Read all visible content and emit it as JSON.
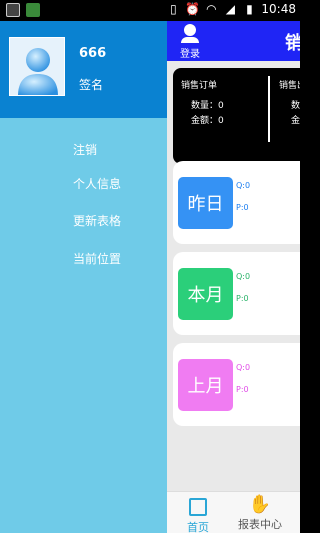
{
  "statusbar": {
    "time": "10:48"
  },
  "topbar": {
    "login_label": "登录",
    "title": "销"
  },
  "summary": {
    "title_left": "销售订单",
    "qty_left": "数量：0",
    "amt_left": "金额：0",
    "title_right": "销售出",
    "qty_right": "数量",
    "amt_right": "金额"
  },
  "cards": [
    {
      "label": "昨日",
      "q": "Q:0",
      "p": "P:0",
      "color": "#3592f4",
      "qcolor": "#1e7ff0",
      "pcolor": "#1e7ff0"
    },
    {
      "label": "本月",
      "q": "Q:0",
      "p": "P:0",
      "color": "#2bcf7a",
      "qcolor": "#2bb46a",
      "pcolor": "#2bb46a"
    },
    {
      "label": "上月",
      "q": "Q:0",
      "p": "P:0",
      "color": "#f07cf2",
      "qcolor": "#e14de8",
      "pcolor": "#e14de8"
    }
  ],
  "bottomnav": {
    "home": "首页",
    "report": "报表中心"
  },
  "drawer": {
    "username": "666",
    "signature": "签名",
    "menu": [
      "注销",
      "个人信息",
      "更新表格",
      "当前位置"
    ]
  },
  "colors": {
    "topbar": "#1f25f5",
    "drawer": "#6fcbe8",
    "profile": "#0a82d1"
  }
}
